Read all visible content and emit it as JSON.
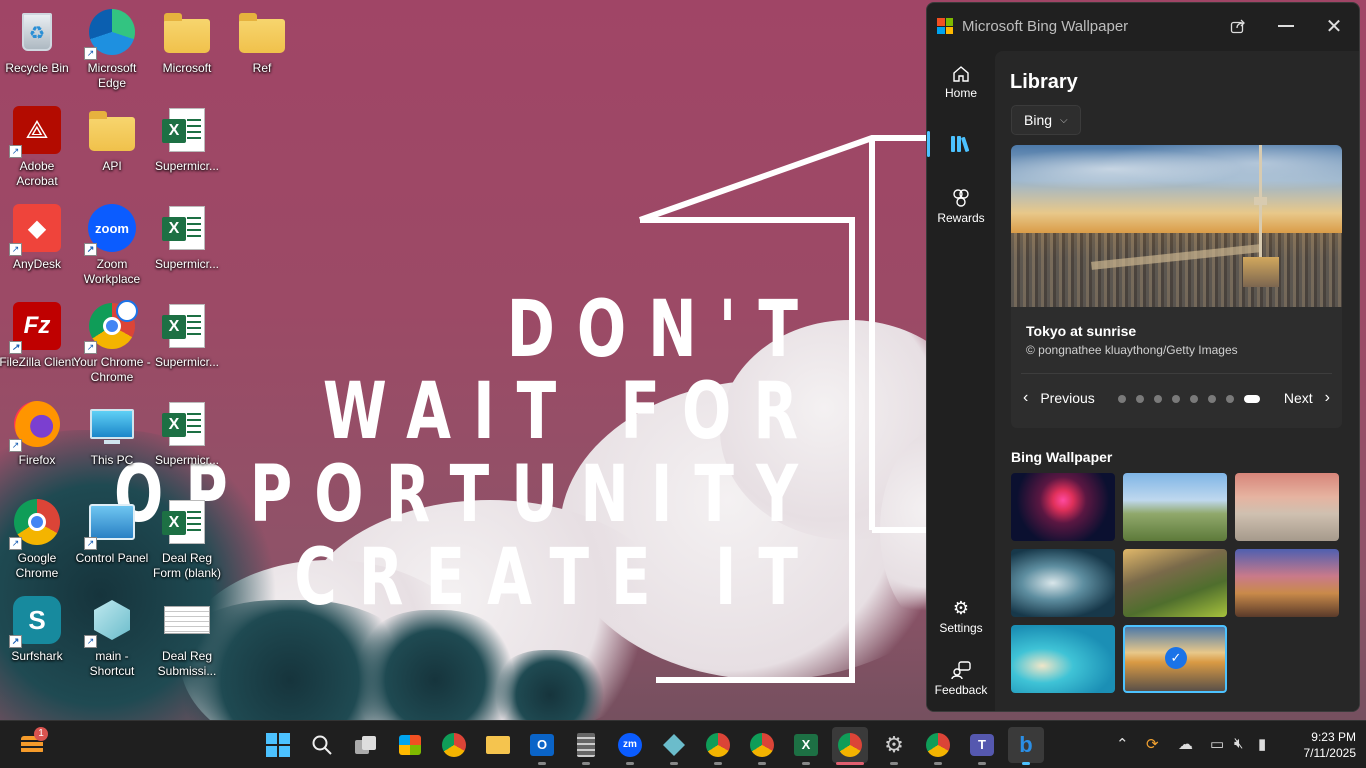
{
  "desktop": {
    "icons": [
      {
        "label": "Recycle Bin",
        "icon": "recycle-bin-icon"
      },
      {
        "label": "Microsoft Edge",
        "icon": "edge-icon"
      },
      {
        "label": "Microsoft",
        "icon": "folder-icon"
      },
      {
        "label": "Ref",
        "icon": "folder-icon"
      },
      {
        "label": "Adobe Acrobat",
        "icon": "acrobat-icon"
      },
      {
        "label": "API",
        "icon": "folder-icon"
      },
      {
        "label": "Supermicr...",
        "icon": "excel-file-icon"
      },
      {
        "label": "AnyDesk",
        "icon": "anydesk-icon"
      },
      {
        "label": "Zoom Workplace",
        "icon": "zoom-icon"
      },
      {
        "label": "Supermicr...",
        "icon": "excel-file-icon"
      },
      {
        "label": "FileZilla Client",
        "icon": "filezilla-icon"
      },
      {
        "label": "Your Chrome - Chrome",
        "icon": "chrome-profile-icon"
      },
      {
        "label": "Supermicr...",
        "icon": "excel-file-icon"
      },
      {
        "label": "Firefox",
        "icon": "firefox-icon"
      },
      {
        "label": "This PC",
        "icon": "monitor-icon"
      },
      {
        "label": "Supermicr...",
        "icon": "excel-file-icon"
      },
      {
        "label": "Google Chrome",
        "icon": "chrome-icon"
      },
      {
        "label": "Control Panel",
        "icon": "control-panel-icon"
      },
      {
        "label": "Deal Reg Form (blank)",
        "icon": "excel-file-icon"
      },
      {
        "label": "Surfshark",
        "icon": "surfshark-icon"
      },
      {
        "label": "main - Shortcut",
        "icon": "app-shortcut-icon"
      },
      {
        "label": "Deal Reg Submissi...",
        "icon": "document-thumbnail-icon"
      }
    ],
    "wallpaper_text": [
      "DON'T",
      "WAIT FOR",
      "OPPORTUNITY",
      "CREATE IT"
    ]
  },
  "bing_app": {
    "title": "Microsoft Bing Wallpaper",
    "nav": [
      {
        "label": "Home",
        "icon": "home-icon"
      },
      {
        "label": "",
        "icon": "library-icon"
      },
      {
        "label": "Rewards",
        "icon": "trophy-icon"
      },
      {
        "label": "Settings",
        "icon": "gear-icon"
      },
      {
        "label": "Feedback",
        "icon": "feedback-icon"
      }
    ],
    "page_title": "Library",
    "source_dropdown": "Bing",
    "hero": {
      "title": "Tokyo at sunrise",
      "credit": "© pongnathee kluaythong/Getty Images",
      "prev_label": "Previous",
      "next_label": "Next",
      "dot_count": 8,
      "active_dot": 8
    },
    "gallery_title": "Bing Wallpaper",
    "gallery_count": 8,
    "selected_thumb": 8
  },
  "taskbar": {
    "notification_badge": "1",
    "apps": [
      "start-icon",
      "search-icon",
      "task-view-icon",
      "store-icon",
      "chrome-icon",
      "file-explorer-icon",
      "outlook-icon",
      "calculator-icon",
      "zoom-icon",
      "app-icon",
      "chrome-icon",
      "chrome-icon",
      "excel-icon",
      "chrome-icon",
      "settings-icon",
      "chrome-icon",
      "teams-icon",
      "bing-icon"
    ],
    "clock_time": "9:23 PM",
    "clock_date": "7/11/2025"
  },
  "colors": {
    "accent": "#4cc2ff",
    "window_bg": "#202020",
    "content_bg": "#272727"
  }
}
